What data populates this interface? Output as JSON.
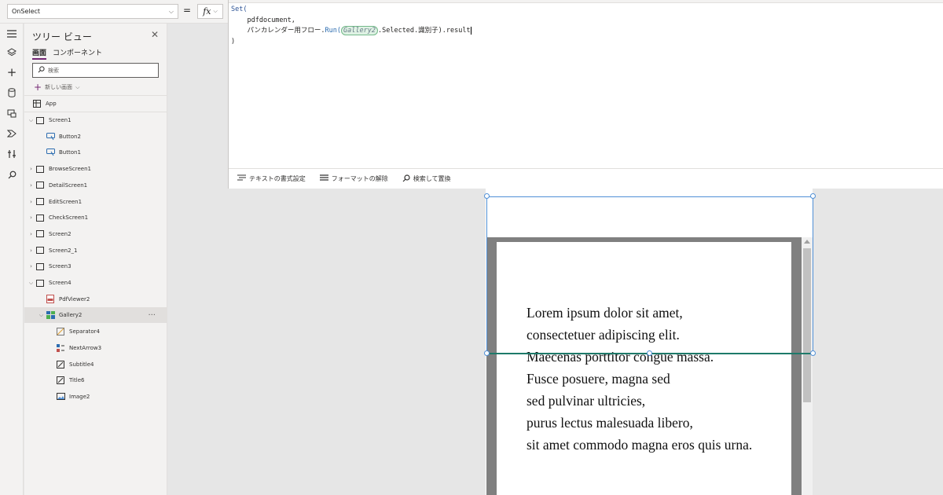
{
  "formula_bar": {
    "property": "OnSelect",
    "equals": "=",
    "fx_label": "fx",
    "code": {
      "line1_kw": "Set(",
      "line2": "pdfdocument,",
      "line3_flow": "パンカレンダー用フロー",
      "line3_dot": ".",
      "line3_run": "Run(",
      "line3_ref": "Gallery2",
      "line3_rest": ".Selected.識別子).result",
      "line4": ")"
    },
    "tools": {
      "format_text": "テキストの書式設定",
      "remove_format": "フォーマットの解除",
      "find_replace": "検索して置換"
    }
  },
  "tree_view": {
    "title": "ツリー ビュー",
    "tabs": [
      "画面",
      "コンポーネント"
    ],
    "search_placeholder": "検索",
    "new_screen": "新しい画面",
    "app_label": "App",
    "nodes": [
      {
        "label": "Screen1",
        "level": 0,
        "expanded": true,
        "icon": "screen-icon"
      },
      {
        "label": "Button2",
        "level": 1,
        "icon": "button-icon"
      },
      {
        "label": "Button1",
        "level": 1,
        "icon": "button-icon"
      },
      {
        "label": "BrowseScreen1",
        "level": 0,
        "expanded": false,
        "icon": "screen-icon"
      },
      {
        "label": "DetailScreen1",
        "level": 0,
        "expanded": false,
        "icon": "screen-icon"
      },
      {
        "label": "EditScreen1",
        "level": 0,
        "expanded": false,
        "icon": "screen-icon"
      },
      {
        "label": "CheckScreen1",
        "level": 0,
        "expanded": false,
        "icon": "screen-icon"
      },
      {
        "label": "Screen2",
        "level": 0,
        "expanded": false,
        "icon": "screen-icon"
      },
      {
        "label": "Screen2_1",
        "level": 0,
        "expanded": false,
        "icon": "screen-icon"
      },
      {
        "label": "Screen3",
        "level": 0,
        "expanded": false,
        "icon": "screen-icon"
      },
      {
        "label": "Screen4",
        "level": 0,
        "expanded": true,
        "icon": "screen-icon"
      },
      {
        "label": "PdfViewer2",
        "level": 1,
        "icon": "pdf-icon"
      },
      {
        "label": "Gallery2",
        "level": 1,
        "expanded": true,
        "selected": true,
        "icon": "gallery-icon"
      },
      {
        "label": "Separator4",
        "level": 2,
        "icon": "separator-icon"
      },
      {
        "label": "NextArrow3",
        "level": 2,
        "icon": "arrow-icon"
      },
      {
        "label": "Subtitle4",
        "level": 2,
        "icon": "label-icon"
      },
      {
        "label": "Title6",
        "level": 2,
        "icon": "label-icon"
      },
      {
        "label": "Image2",
        "level": 2,
        "icon": "image-icon"
      }
    ]
  },
  "pdf_viewer": {
    "lines": [
      "Lorem ipsum dolor sit amet,",
      "consectetuer adipiscing elit.",
      "Maecenas porttitor congue massa.",
      "Fusce posuere, magna sed",
      "sed pulvinar ultricies,",
      "purus lectus malesuada libero,",
      "sit amet commodo magna eros quis urna."
    ]
  },
  "colors": {
    "accent": "#742774",
    "selection": "#4f8fd6",
    "separator": "#1e7a6a"
  }
}
